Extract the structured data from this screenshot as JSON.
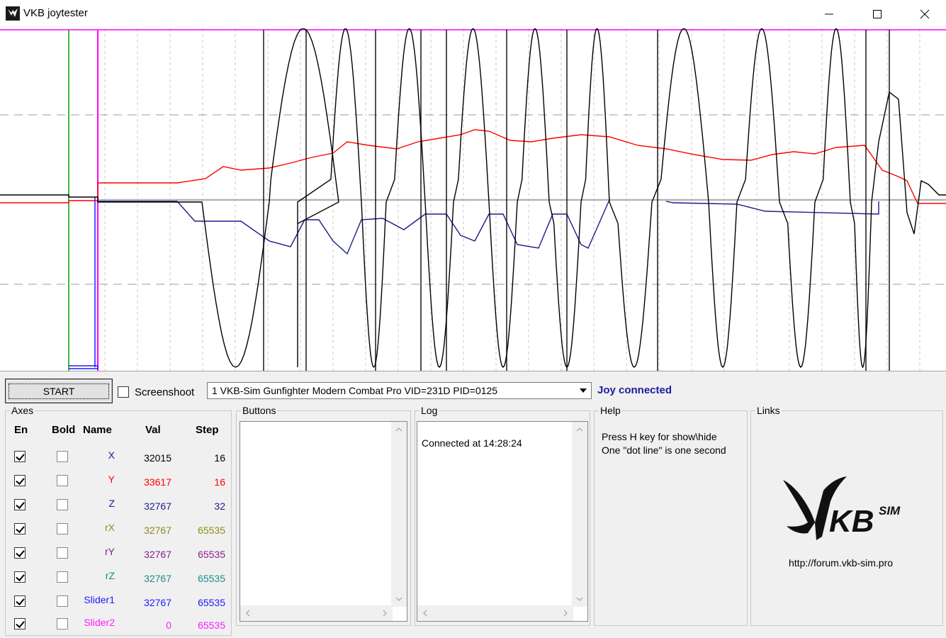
{
  "window": {
    "title": "VKB joytester",
    "minimize_icon": "minimize-icon",
    "maximize_icon": "maximize-icon",
    "close_icon": "close-icon"
  },
  "toolbar": {
    "start_label": "START",
    "screenshot_label": "Screenshoot",
    "screenshot_checked": false,
    "device": "1  VKB-Sim Gunfighter Modern Combat Pro  VID=231D PID=0125",
    "status": "Joy connected",
    "status_color": "#1b1b9e"
  },
  "axes": {
    "group_label": "Axes",
    "headers": {
      "en": "En",
      "bold": "Bold",
      "name": "Name",
      "val": "Val",
      "step": "Step"
    },
    "rows": [
      {
        "name": "X",
        "val": "32015",
        "step": "16",
        "enabled": true,
        "bold": false,
        "name_color": "#1c1c8c",
        "val_color": "#000000",
        "step_color": "#000000"
      },
      {
        "name": "Y",
        "val": "33617",
        "step": "16",
        "enabled": true,
        "bold": false,
        "name_color": "#ff0000",
        "val_color": "#ff0000",
        "step_color": "#ff0000"
      },
      {
        "name": "Z",
        "val": "32767",
        "step": "32",
        "enabled": true,
        "bold": false,
        "name_color": "#1c1c8c",
        "val_color": "#1c1c8c",
        "step_color": "#1c1c8c"
      },
      {
        "name": "rX",
        "val": "32767",
        "step": "65535",
        "enabled": true,
        "bold": false,
        "name_color": "#8c8c1c",
        "val_color": "#8c8c1c",
        "step_color": "#8c8c1c"
      },
      {
        "name": "rY",
        "val": "32767",
        "step": "65535",
        "enabled": true,
        "bold": false,
        "name_color": "#8c1c8c",
        "val_color": "#8c1c8c",
        "step_color": "#8c1c8c"
      },
      {
        "name": "rZ",
        "val": "32767",
        "step": "65535",
        "enabled": true,
        "bold": false,
        "name_color": "#1c8c8c",
        "val_color": "#1c8c8c",
        "step_color": "#1c8c8c"
      },
      {
        "name": "Slider1",
        "val": "32767",
        "step": "65535",
        "enabled": true,
        "bold": false,
        "name_color": "#1c1cff",
        "val_color": "#1c1cff",
        "step_color": "#1c1cff"
      },
      {
        "name": "Slider2",
        "val": "0",
        "step": "65535",
        "enabled": true,
        "bold": false,
        "name_color": "#ff1cff",
        "val_color": "#ff1cff",
        "step_color": "#ff1cff"
      }
    ]
  },
  "buttons_group": {
    "label": "Buttons"
  },
  "log_group": {
    "label": "Log",
    "lines": [
      "Connected at 14:28:24"
    ]
  },
  "help_group": {
    "label": "Help",
    "line1": "Press H key for show\\hide",
    "line2": "One \"dot line\" is one second"
  },
  "links_group": {
    "label": "Links",
    "logo_text": "KB",
    "logo_sup": "SIM",
    "url": "http://forum.vkb-sim.pro"
  },
  "plot": {
    "background": "#ffffff",
    "series_colors": {
      "x": "#000000",
      "y": "#ff0000",
      "z": "#1c1c8c",
      "slider1": "#1c1cff",
      "slider2": "#ff00ff",
      "cursor": "#00a000"
    }
  }
}
